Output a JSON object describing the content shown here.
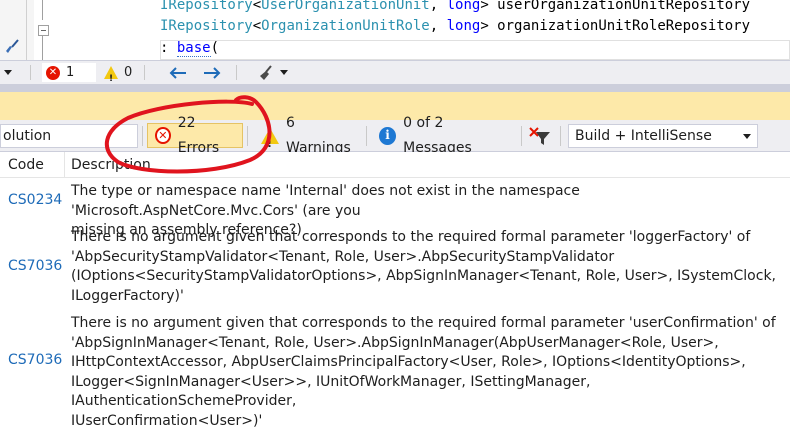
{
  "editor": {
    "lines": [
      {
        "parts": [
          {
            "t": "IRepository",
            "c": "tp"
          },
          {
            "t": "<",
            "c": ""
          },
          {
            "t": "UserOrganizationUnit",
            "c": "tp"
          },
          {
            "t": ", ",
            "c": ""
          },
          {
            "t": "long",
            "c": "kw"
          },
          {
            "t": "> userOrganizationUnitRepository",
            "c": ""
          }
        ]
      },
      {
        "parts": [
          {
            "t": "IRepository",
            "c": "tp"
          },
          {
            "t": "<",
            "c": ""
          },
          {
            "t": "OrganizationUnitRole",
            "c": "tp"
          },
          {
            "t": ", ",
            "c": ""
          },
          {
            "t": "long",
            "c": "kw"
          },
          {
            "t": "> organizationUnitRoleRepository",
            "c": ""
          }
        ]
      },
      {
        "parts": [
          {
            "t": ": ",
            "c": ""
          },
          {
            "t": "base",
            "c": "kw sq"
          },
          {
            "t": "(",
            "c": ""
          }
        ]
      }
    ]
  },
  "status_strip": {
    "zoom": "0",
    "error_count": "1",
    "warning_count": "0"
  },
  "toolbar": {
    "scope_label": "olution",
    "errors_label": "22 Errors",
    "warnings_label": "6 Warnings",
    "messages_label": "0 of 2 Messages",
    "build_filter": "Build + IntelliSense"
  },
  "grid": {
    "columns": {
      "code": "Code",
      "description": "Description"
    },
    "rows": [
      {
        "code": "CS0234",
        "description": "The type or namespace name 'Internal' does not exist in the namespace 'Microsoft.AspNetCore.Mvc.Cors' (are you\nmissing an assembly reference?)"
      },
      {
        "code": "CS7036",
        "description": "There is no argument given that corresponds to the required formal parameter 'loggerFactory' of\n'AbpSecurityStampValidator<Tenant, Role, User>.AbpSecurityStampValidator\n(IOptions<SecurityStampValidatorOptions>, AbpSignInManager<Tenant, Role, User>, ISystemClock,\nILoggerFactory)'"
      },
      {
        "code": "CS7036",
        "description": "There is no argument given that corresponds to the required formal parameter 'userConfirmation' of\n'AbpSignInManager<Tenant, Role, User>.AbpSignInManager(AbpUserManager<Role, User>,\nIHttpContextAccessor, AbpUserClaimsPrincipalFactory<User, Role>, IOptions<IdentityOptions>,\nILogger<SignInManager<User>>, IUnitOfWorkManager, ISettingManager, IAuthenticationSchemeProvider,\nIUserConfirmation<User>)'"
      }
    ]
  },
  "colors": {
    "accent_red": "#e51400",
    "warning_yellow": "#f2c811",
    "info_blue": "#1e78d3",
    "link_blue": "#1e6bb8",
    "panel_highlight": "#fde9a9"
  }
}
